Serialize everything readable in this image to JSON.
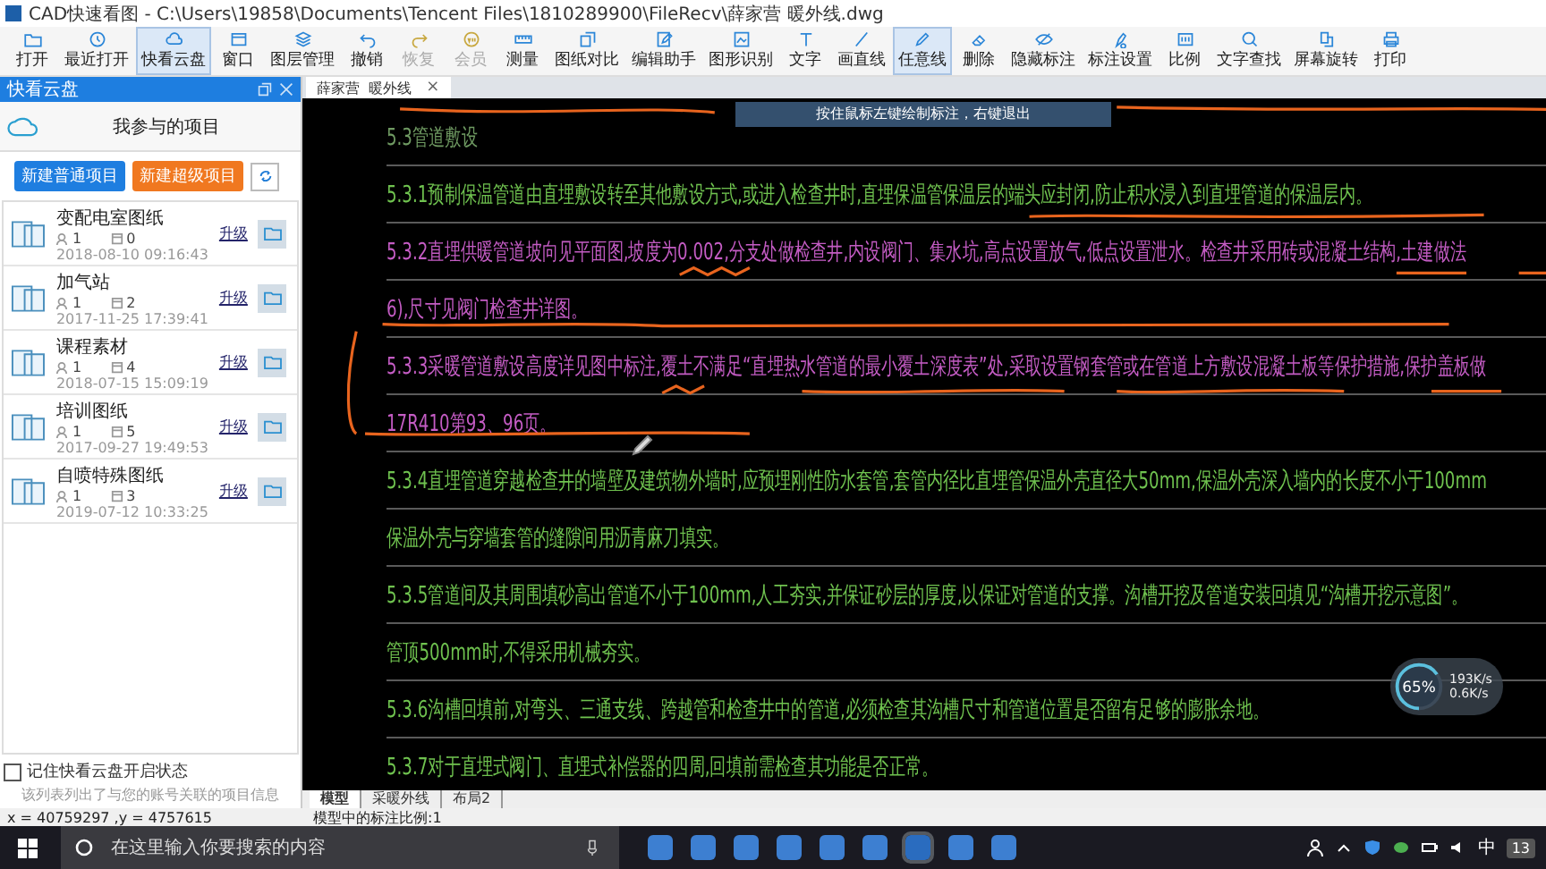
{
  "window": {
    "title": "CAD快速看图 - C:\\Users\\19858\\Documents\\Tencent Files\\1810289900\\FileRecv\\薛家营  暖外线.dwg"
  },
  "toolbar": [
    {
      "label": "打开",
      "selected": false,
      "disabled": false
    },
    {
      "label": "最近打开",
      "selected": false,
      "disabled": false
    },
    {
      "label": "快看云盘",
      "selected": true,
      "disabled": false
    },
    {
      "label": "窗口",
      "selected": false,
      "disabled": false
    },
    {
      "label": "图层管理",
      "selected": false,
      "disabled": false
    },
    {
      "label": "撤销",
      "selected": false,
      "disabled": false
    },
    {
      "label": "恢复",
      "selected": false,
      "disabled": true
    },
    {
      "label": "会员",
      "selected": false,
      "disabled": true
    },
    {
      "label": "测量",
      "selected": false,
      "disabled": false
    },
    {
      "label": "图纸对比",
      "selected": false,
      "disabled": false
    },
    {
      "label": "编辑助手",
      "selected": false,
      "disabled": false
    },
    {
      "label": "图形识别",
      "selected": false,
      "disabled": false
    },
    {
      "label": "文字",
      "selected": false,
      "disabled": false
    },
    {
      "label": "画直线",
      "selected": false,
      "disabled": false
    },
    {
      "label": "任意线",
      "selected": true,
      "disabled": false
    },
    {
      "label": "删除",
      "selected": false,
      "disabled": false
    },
    {
      "label": "隐藏标注",
      "selected": false,
      "disabled": false
    },
    {
      "label": "标注设置",
      "selected": false,
      "disabled": false
    },
    {
      "label": "比例",
      "selected": false,
      "disabled": false
    },
    {
      "label": "文字查找",
      "selected": false,
      "disabled": false
    },
    {
      "label": "屏幕旋转",
      "selected": false,
      "disabled": false
    },
    {
      "label": "打印",
      "selected": false,
      "disabled": false
    }
  ],
  "cloud_panel": {
    "title": "快看云盘",
    "heading": "我参与的项目",
    "buttons": [
      {
        "label": "新建普通项目",
        "kind": "normal"
      },
      {
        "label": "新建超级项目",
        "kind": "super"
      }
    ],
    "projects": [
      {
        "name": "变配电室图纸",
        "members": "1",
        "files": "0",
        "date": "2018-08-10 09:16:43",
        "action": "升级"
      },
      {
        "name": "加气站",
        "members": "1",
        "files": "2",
        "date": "2017-11-25 17:39:41",
        "action": "升级"
      },
      {
        "name": "课程素材",
        "members": "1",
        "files": "4",
        "date": "2018-07-15 15:09:19",
        "action": "升级"
      },
      {
        "name": "培训图纸",
        "members": "1",
        "files": "5",
        "date": "2017-09-27 19:49:53",
        "action": "升级"
      },
      {
        "name": "自喷特殊图纸",
        "members": "1",
        "files": "3",
        "date": "2019-07-12 10:33:25",
        "action": "升级"
      }
    ],
    "remember": {
      "label": "记住快看云盘开启状态",
      "checked": false
    },
    "note": "该列表列出了与您的账号关联的项目信息"
  },
  "document_tab": {
    "title": "薛家营  暖外线",
    "close": "×"
  },
  "tooltip": "按住鼠标左键绘制标注，右键退出",
  "drawing": {
    "lines": [
      {
        "text": "5.3管道敷设",
        "color": "#6f9a62"
      },
      {
        "text": "5.3.1预制保温管道由直埋敷设转至其他敷设方式,或进入检查井时,直埋保温管保温层的端头应封闭,防止积水浸入到直埋管道的保温层内。",
        "color": "#6fc24f"
      },
      {
        "text": "5.3.2直埋供暖管道坡向见平面图,坡度为0.002,分支处做检查井,内设阀门、集水坑,高点设置放气,低点设置泄水。检查井采用砖或混凝土结构,土建做法",
        "color": "#c45cc4"
      },
      {
        "text": "6),尺寸见阀门检查井详图。",
        "color": "#c45cc4"
      },
      {
        "text": "5.3.3采暖管道敷设高度详见图中标注,覆土不满足“直埋热水管道的最小覆土深度表”处,采取设置钢套管或在管道上方敷设混凝土板等保护措施,保护盖板做",
        "color": "#c45cc4"
      },
      {
        "text": "17R410第93、96页。",
        "color": "#c45cc4"
      },
      {
        "text": "5.3.4直埋管道穿越检查井的墙壁及建筑物外墙时,应预埋刚性防水套管,套管内径比直埋管保温外壳直径大50mm,保温外壳深入墙内的长度不小于100mm",
        "color": "#6fc24f"
      },
      {
        "text": "保温外壳与穿墙套管的缝隙间用沥青麻刀填实。",
        "color": "#6fc24f"
      },
      {
        "text": "5.3.5管道间及其周围填砂高出管道不小于100mm,人工夯实,并保证砂层的厚度,以保证对管道的支撑。沟槽开挖及管道安装回填见“沟槽开挖示意图”。",
        "color": "#6fc24f"
      },
      {
        "text": "管顶500mm时,不得采用机械夯实。",
        "color": "#6fc24f"
      },
      {
        "text": "5.3.6沟槽回填前,对弯头、三通支线、跨越管和检查井中的管道,必须检查其沟槽尺寸和管道位置是否留有足够的膨胀余地。",
        "color": "#6fc24f"
      },
      {
        "text": "5.3.7对于直埋式阀门、直埋式补偿器的四周,回填前需检查其功能是否正常。",
        "color": "#6fc24f"
      }
    ]
  },
  "speed_meter": {
    "percent": "65%",
    "level": 0.65,
    "upload": "193K/s",
    "download": "0.6K/s"
  },
  "layout_tabs": [
    {
      "label": "模型",
      "selected": true
    },
    {
      "label": "采暖外线",
      "selected": false
    },
    {
      "label": "布局2",
      "selected": false
    }
  ],
  "status": {
    "coordinates": "x = 40759297 ,y = 4757615",
    "scale": "模型中的标注比例:1"
  },
  "taskbar": {
    "search_placeholder": "在这里输入你要搜索的内容",
    "ime": "中",
    "badge": "13"
  }
}
